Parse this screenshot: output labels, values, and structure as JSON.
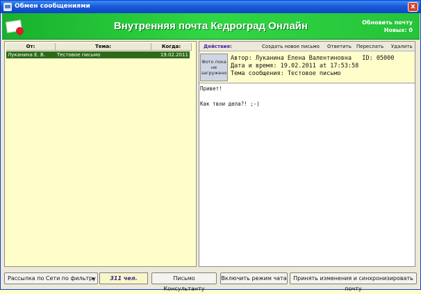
{
  "window": {
    "title": "Обмен сообщениями",
    "close_glyph": "x"
  },
  "header": {
    "title": "Внутренняя почта Кедроград Онлайн",
    "refresh_label": "Обновить почту",
    "new_count_text": "Новых: 0",
    "logo_icon": "mail-logo-icon"
  },
  "list": {
    "columns": [
      "От:",
      "Тема:",
      "Когда:"
    ],
    "rows": [
      {
        "from": "Луканина Е. В.",
        "subject": "Тестовое письмо",
        "date": "19.02.2011"
      }
    ]
  },
  "actions": {
    "label": "Действия:",
    "new_letter": "Создать новое письмо",
    "reply": "Ответить",
    "forward": "Переслать",
    "delete": "Удалить"
  },
  "message": {
    "photo_text": "Фото пока не загружено",
    "author_line": "Автор: Луканина Елена Валентиновна   ID: 05000",
    "datetime_line": "Дата и время: 19.02.2011 at 17:53:58",
    "subject_line": "Тема сообщения: Тестовое письмо",
    "body": "Привет!\n\nКак твои дела?! ;-)"
  },
  "bottom": {
    "mailing_label": "Рассылка по Сети по фильтру",
    "count_text": "311 чел.",
    "consultant_label": "Письмо Консультанту",
    "chat_label": "Включить режим чата",
    "sync_label": "Принять изменения и синхронизировать почту"
  },
  "colors": {
    "header_green": "#25c33a",
    "selection_green": "#2d6a1c",
    "panel_yellow": "#fffecb",
    "accent_purple": "#4a1ea6"
  }
}
